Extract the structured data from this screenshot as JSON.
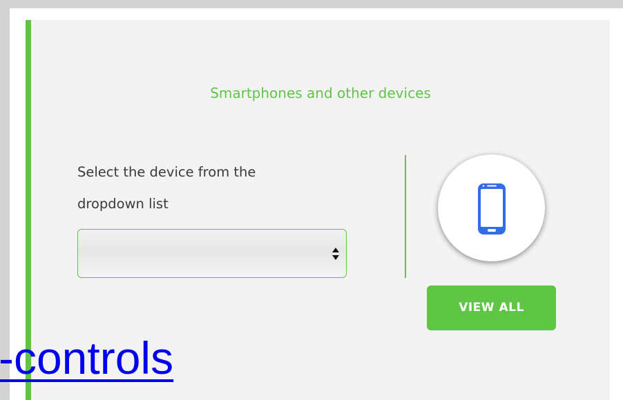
{
  "card": {
    "heading": "Smartphones and other devices",
    "instructions_line1": "Select the device from the",
    "instructions_line2": "dropdown list",
    "select_value": ""
  },
  "button": {
    "view_all": "VIEW ALL"
  },
  "overlay": {
    "link_text": "-controls"
  },
  "icons": {
    "phone": "smartphone-icon",
    "select_arrows": "updown-arrows-icon"
  },
  "colors": {
    "accent": "#5ec644",
    "phone_icon": "#2f6ee8",
    "link": "#0000ee"
  }
}
